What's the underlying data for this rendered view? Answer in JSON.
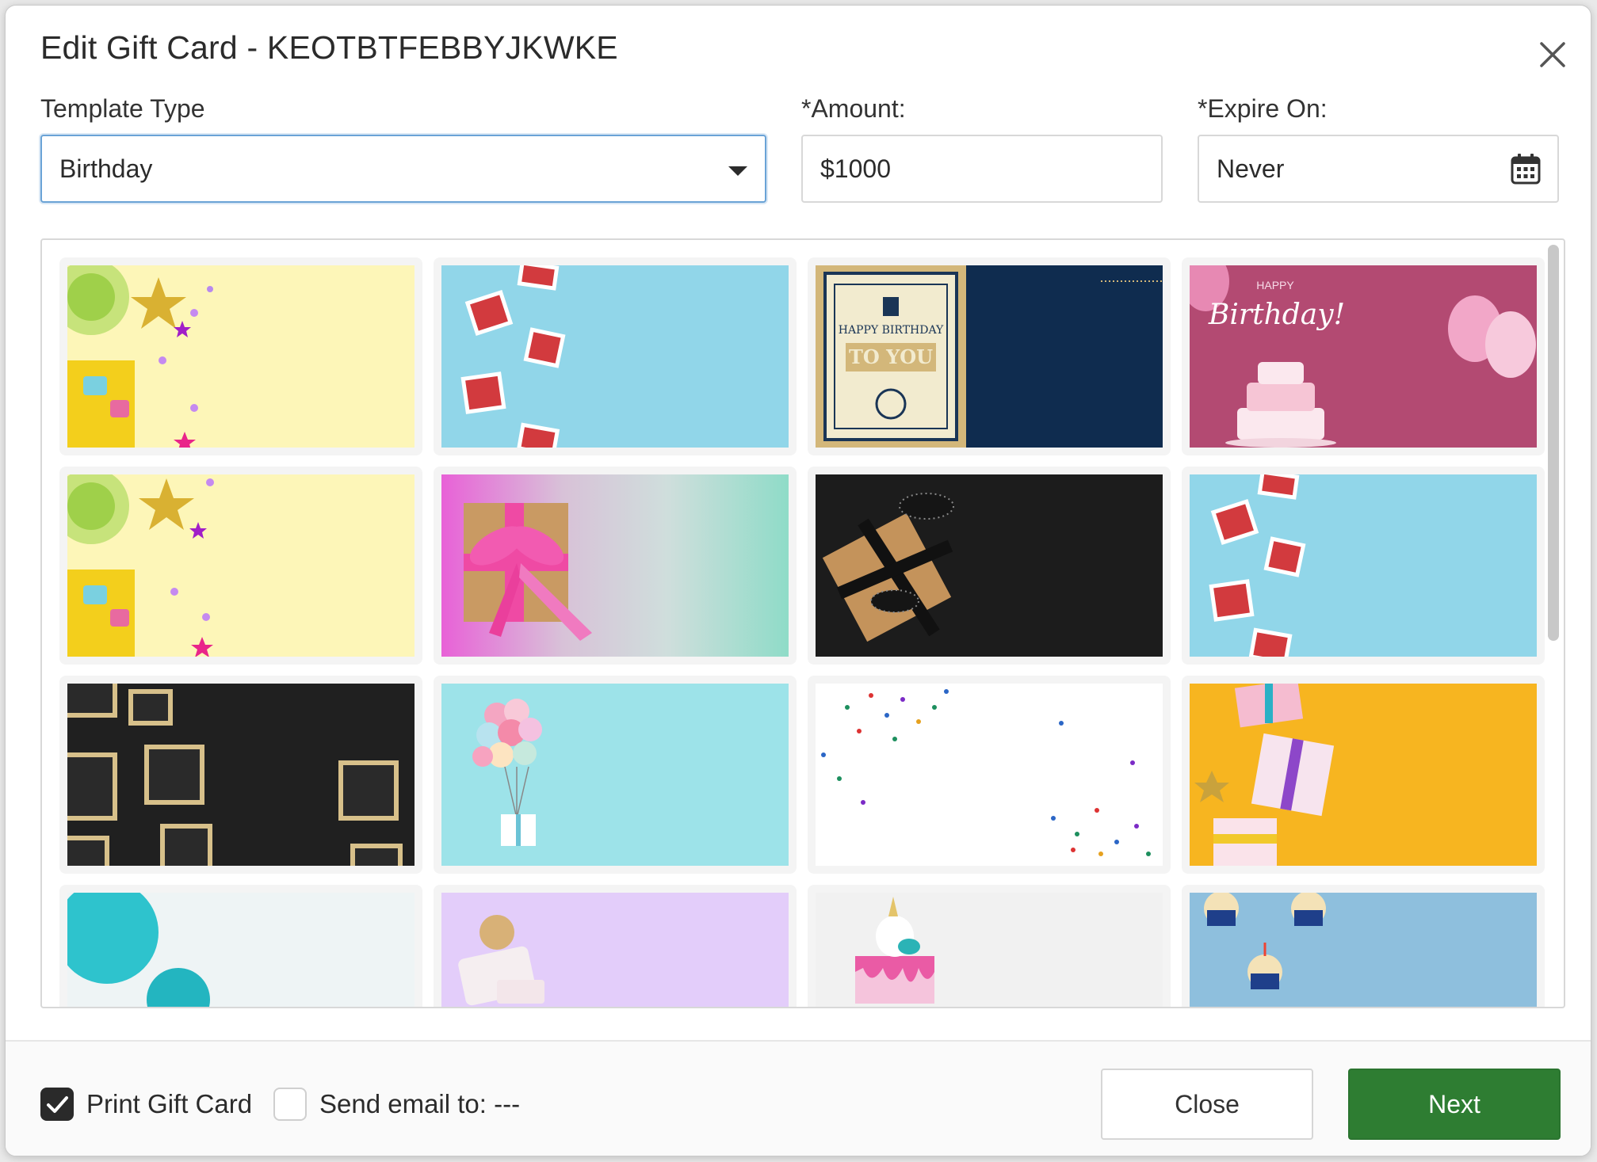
{
  "dialog": {
    "title": "Edit Gift Card - KEOTBTFEBBYJKWKE"
  },
  "form": {
    "template_type": {
      "label": "Template Type",
      "value": "Birthday"
    },
    "amount": {
      "label": "*Amount:",
      "value": "$1000"
    },
    "expire_on": {
      "label": "*Expire On:",
      "value": "Never"
    }
  },
  "gallery": {
    "templates": [
      {
        "name": "yellow-cupcake-stars"
      },
      {
        "name": "blue-red-gift-boxes"
      },
      {
        "name": "happy-birthday-to-you-navy",
        "text_line1": "HAPPY BIRTHDAY",
        "text_line2": "TO YOU"
      },
      {
        "name": "pink-birthday-cake",
        "text_line1": "HAPPY",
        "text_line2": "Birthday!"
      },
      {
        "name": "yellow-cupcake-stars-2"
      },
      {
        "name": "pink-ribbon-gift"
      },
      {
        "name": "black-polka-dot-gift"
      },
      {
        "name": "blue-red-gift-boxes-2"
      },
      {
        "name": "black-gold-gifts"
      },
      {
        "name": "teal-balloon-gift"
      },
      {
        "name": "white-confetti"
      },
      {
        "name": "yellow-pink-gifts"
      },
      {
        "name": "teal-balloons"
      },
      {
        "name": "lavender-gift-box"
      },
      {
        "name": "unicorn-cake"
      },
      {
        "name": "blue-cupcakes"
      }
    ]
  },
  "footer": {
    "print_label": "Print Gift Card",
    "print_checked": true,
    "email_label": "Send email to: ---",
    "email_checked": false,
    "close_label": "Close",
    "next_label": "Next"
  },
  "colors": {
    "accent": "#2e7d32",
    "focus": "#6aa3d6"
  }
}
